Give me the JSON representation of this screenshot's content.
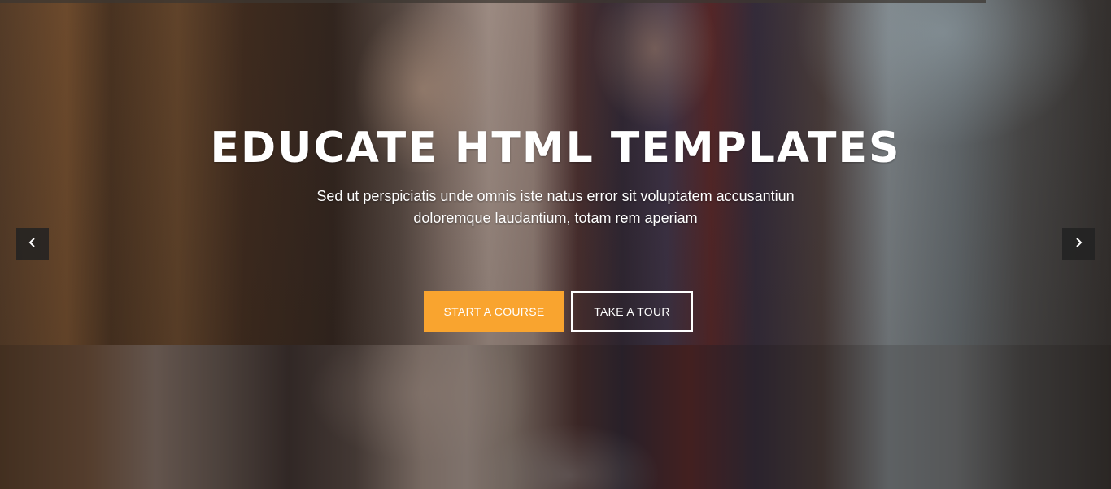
{
  "hero": {
    "title": "EDUCATE HTML TEMPLATES",
    "subtitle_line1": "Sed ut perspiciatis unde omnis iste natus error sit voluptatem accusantiun",
    "subtitle_line2": "doloremque laudantium, totam rem aperiam",
    "primary_button_label": "START A COURSE",
    "secondary_button_label": "TAKE A TOUR",
    "accent_color": "#f9a42f",
    "prev_icon": "chevron-left-icon",
    "next_icon": "chevron-right-icon"
  }
}
